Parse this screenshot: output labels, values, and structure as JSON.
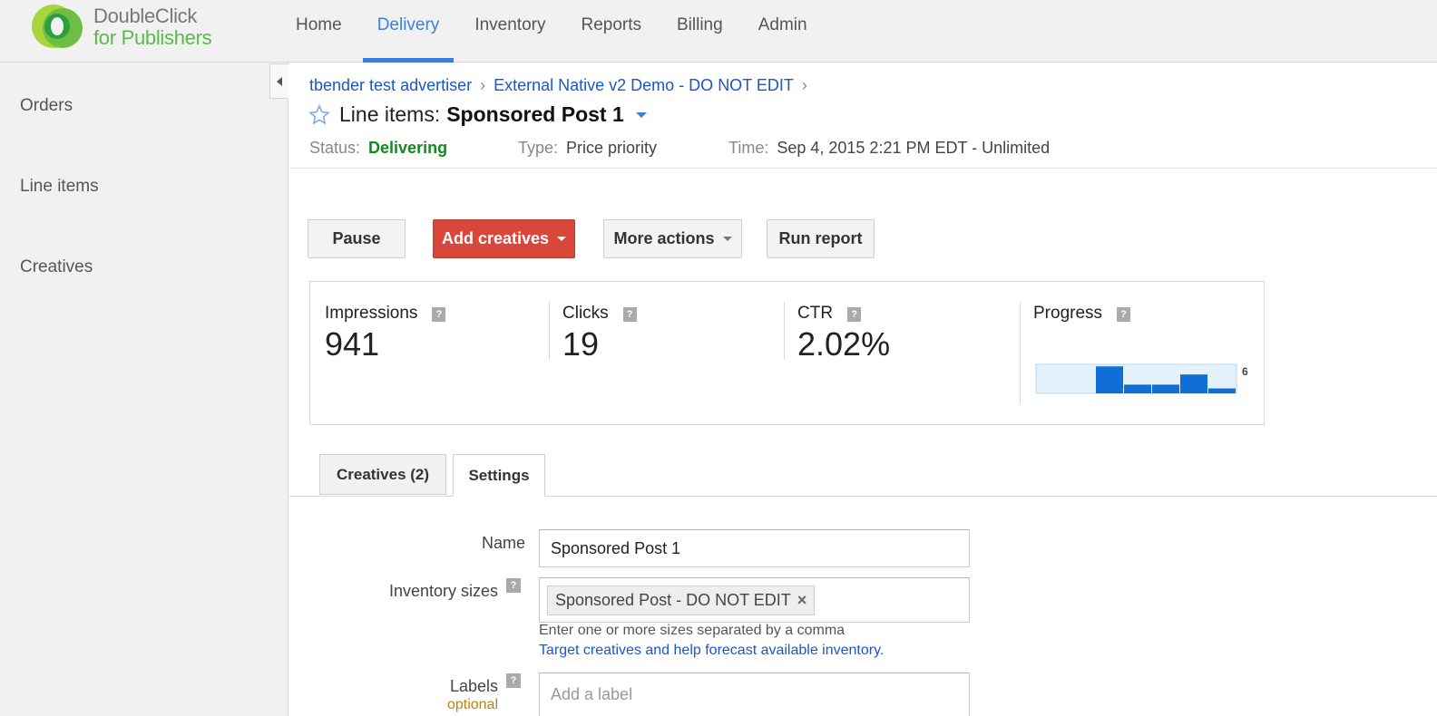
{
  "header": {
    "logo_line1": "DoubleClick",
    "logo_line2": "for Publishers",
    "nav": [
      {
        "label": "Home"
      },
      {
        "label": "Delivery"
      },
      {
        "label": "Inventory"
      },
      {
        "label": "Reports"
      },
      {
        "label": "Billing"
      },
      {
        "label": "Admin"
      }
    ],
    "active_nav": "Delivery"
  },
  "sidebar": {
    "items": [
      {
        "label": "Orders"
      },
      {
        "label": "Line items"
      },
      {
        "label": "Creatives"
      }
    ]
  },
  "breadcrumb": {
    "items": [
      "tbender test advertiser",
      "External Native v2 Demo - DO NOT EDIT"
    ],
    "separator": "›"
  },
  "page": {
    "title_prefix": "Line items:",
    "title_name": "Sponsored Post 1",
    "status_label": "Status:",
    "status_value": "Delivering",
    "type_label": "Type:",
    "type_value": "Price priority",
    "time_label": "Time:",
    "time_value": "Sep 4, 2015 2:21 PM EDT - Unlimited"
  },
  "actions": {
    "pause": "Pause",
    "add_creatives": "Add creatives",
    "more_actions": "More actions",
    "run_report": "Run report"
  },
  "stats": {
    "impressions_label": "Impressions",
    "impressions_value": "941",
    "clicks_label": "Clicks",
    "clicks_value": "19",
    "ctr_label": "CTR",
    "ctr_value": "2.02%",
    "progress_label": "Progress",
    "progress_axis_label": "6",
    "progress_bars": [
      0.93,
      0.3,
      0.3,
      0.65,
      0.17
    ],
    "help_glyph": "?"
  },
  "tabs": [
    {
      "label": "Creatives (2)"
    },
    {
      "label": "Settings"
    }
  ],
  "form": {
    "name_label": "Name",
    "name_value": "Sponsored Post 1",
    "inventory_label": "Inventory sizes",
    "inventory_chip": "Sponsored Post - DO NOT EDIT",
    "inventory_chip_remove": "×",
    "inventory_hint": "Enter one or more sizes separated by a comma",
    "inventory_link": "Target creatives and help forecast available inventory.",
    "labels_label": "Labels",
    "labels_optional": "optional",
    "labels_placeholder": "Add a label"
  },
  "colors": {
    "accent_blue": "#3a7fe0",
    "link_blue": "#1a57c7",
    "status_green": "#138a1f",
    "button_red": "#d9473b",
    "logo_green": "#5bb94b",
    "optional_orange": "#b7860b"
  },
  "icons": {
    "star": "star-outline-icon",
    "caret": "chevron-down-icon",
    "collapse": "collapse-left-icon",
    "help": "help-icon",
    "remove": "close-icon"
  }
}
